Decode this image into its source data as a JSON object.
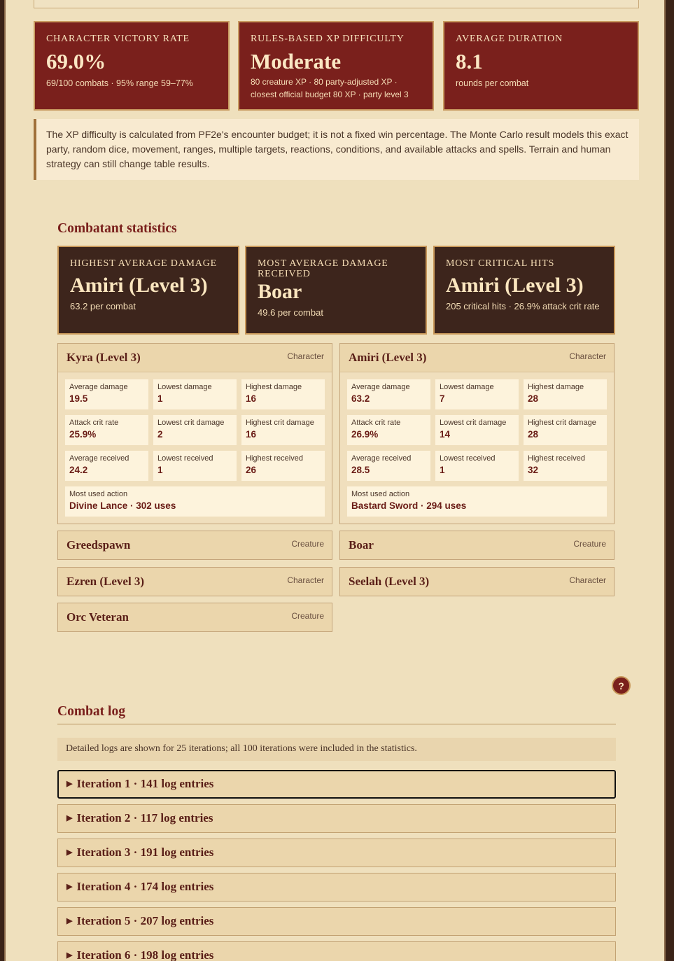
{
  "summary": [
    {
      "label": "Character victory rate",
      "value": "69.0%",
      "sub": "69/100 combats · 95% range 59–77%"
    },
    {
      "label": "Rules-based XP difficulty",
      "value": "Moderate",
      "sub": "80 creature XP · 80 party-adjusted XP · closest official budget 80 XP · party level 3"
    },
    {
      "label": "Average duration",
      "value": "8.1",
      "sub": "rounds per combat"
    }
  ],
  "note": "The XP difficulty is calculated from PF2e's encounter budget; it is not a fixed win percentage. The Monte Carlo result models this exact party, random dice, movement, ranges, multiple targets, reactions, conditions, and available attacks and spells. Terrain and human strategy can still change table results.",
  "combatant_title": "Combatant statistics",
  "highlights": [
    {
      "label": "Highest average damage",
      "value": "Amiri (Level 3)",
      "sub": "63.2 per combat"
    },
    {
      "label": "Most average damage received",
      "value": "Boar",
      "sub": "49.6 per combat"
    },
    {
      "label": "Most critical hits",
      "value": "Amiri (Level 3)",
      "sub": "205 critical hits · 26.9% attack crit rate"
    }
  ],
  "combatants": {
    "kyra": {
      "name": "Kyra (Level 3)",
      "type": "Character",
      "stats": [
        {
          "label": "Average damage",
          "value": "19.5"
        },
        {
          "label": "Lowest damage",
          "value": "1"
        },
        {
          "label": "Highest damage",
          "value": "16"
        },
        {
          "label": "Attack crit rate",
          "value": "25.9%"
        },
        {
          "label": "Lowest crit damage",
          "value": "2"
        },
        {
          "label": "Highest crit damage",
          "value": "16"
        },
        {
          "label": "Average received",
          "value": "24.2"
        },
        {
          "label": "Lowest received",
          "value": "1"
        },
        {
          "label": "Highest received",
          "value": "26"
        }
      ],
      "most_used_label": "Most used action",
      "most_used_value": "Divine Lance · 302 uses"
    },
    "amiri": {
      "name": "Amiri (Level 3)",
      "type": "Character",
      "stats": [
        {
          "label": "Average damage",
          "value": "63.2"
        },
        {
          "label": "Lowest damage",
          "value": "7"
        },
        {
          "label": "Highest damage",
          "value": "28"
        },
        {
          "label": "Attack crit rate",
          "value": "26.9%"
        },
        {
          "label": "Lowest crit damage",
          "value": "14"
        },
        {
          "label": "Highest crit damage",
          "value": "28"
        },
        {
          "label": "Average received",
          "value": "28.5"
        },
        {
          "label": "Lowest received",
          "value": "1"
        },
        {
          "label": "Highest received",
          "value": "32"
        }
      ],
      "most_used_label": "Most used action",
      "most_used_value": "Bastard Sword · 294 uses"
    },
    "collapsed": [
      {
        "name": "Greedspawn",
        "type": "Creature"
      },
      {
        "name": "Boar",
        "type": "Creature"
      },
      {
        "name": "Ezren (Level 3)",
        "type": "Character"
      },
      {
        "name": "Seelah (Level 3)",
        "type": "Character"
      },
      {
        "name": "Orc Veteran",
        "type": "Creature"
      }
    ]
  },
  "help_label": "?",
  "log": {
    "title": "Combat log",
    "note": "Detailed logs are shown for 25 iterations; all 100 iterations were included in the statistics.",
    "iterations": [
      "Iteration 1 · 141 log entries",
      "Iteration 2 · 117 log entries",
      "Iteration 3 · 191 log entries",
      "Iteration 4 · 174 log entries",
      "Iteration 5 · 207 log entries",
      "Iteration 6 · 198 log entries"
    ]
  },
  "icons": {
    "expand": "triangle-right-icon",
    "help": "question-icon"
  },
  "colors": {
    "accent": "#7a201c",
    "dark_card": "#3d251c",
    "page": "#efe0bd"
  }
}
